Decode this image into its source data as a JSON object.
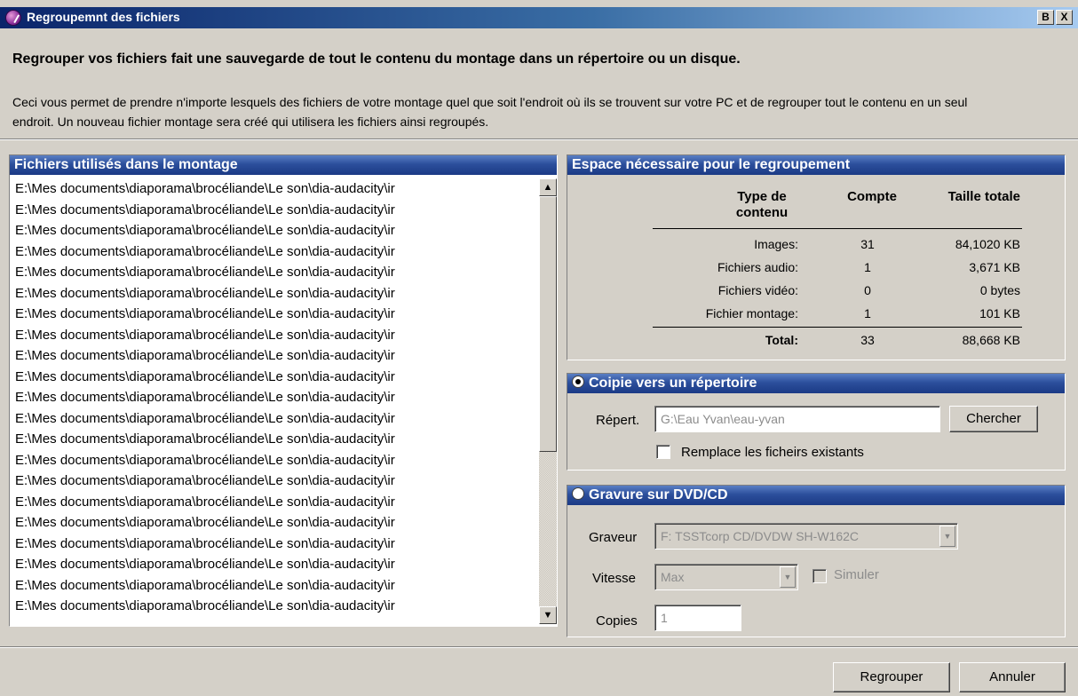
{
  "window": {
    "title": "Regroupemnt des fichiers",
    "restore_glyph": "B",
    "close_glyph": "X"
  },
  "intro": {
    "heading": "Regrouper vos fichiers fait une sauvegarde de tout le contenu du montage dans un répertoire ou un disque.",
    "description": "Ceci vous permet de prendre n'importe lesquels des fichiers de votre montage quel que soit l'endroit où ils se trouvent sur votre PC et de regrouper tout le contenu en un seul endroit. Un nouveau fichier montage sera créé qui utilisera les fichiers ainsi regroupés."
  },
  "files": {
    "title": "Fichiers utilisés dans le montage",
    "items": [
      "E:\\Mes documents\\diaporama\\brocéliande\\Le son\\dia-audacity\\ir",
      "E:\\Mes documents\\diaporama\\brocéliande\\Le son\\dia-audacity\\ir",
      "E:\\Mes documents\\diaporama\\brocéliande\\Le son\\dia-audacity\\ir",
      "E:\\Mes documents\\diaporama\\brocéliande\\Le son\\dia-audacity\\ir",
      "E:\\Mes documents\\diaporama\\brocéliande\\Le son\\dia-audacity\\ir",
      "E:\\Mes documents\\diaporama\\brocéliande\\Le son\\dia-audacity\\ir",
      "E:\\Mes documents\\diaporama\\brocéliande\\Le son\\dia-audacity\\ir",
      "E:\\Mes documents\\diaporama\\brocéliande\\Le son\\dia-audacity\\ir",
      "E:\\Mes documents\\diaporama\\brocéliande\\Le son\\dia-audacity\\ir",
      "E:\\Mes documents\\diaporama\\brocéliande\\Le son\\dia-audacity\\ir",
      "E:\\Mes documents\\diaporama\\brocéliande\\Le son\\dia-audacity\\ir",
      "E:\\Mes documents\\diaporama\\brocéliande\\Le son\\dia-audacity\\ir",
      "E:\\Mes documents\\diaporama\\brocéliande\\Le son\\dia-audacity\\ir",
      "E:\\Mes documents\\diaporama\\brocéliande\\Le son\\dia-audacity\\ir",
      "E:\\Mes documents\\diaporama\\brocéliande\\Le son\\dia-audacity\\ir",
      "E:\\Mes documents\\diaporama\\brocéliande\\Le son\\dia-audacity\\ir",
      "E:\\Mes documents\\diaporama\\brocéliande\\Le son\\dia-audacity\\ir",
      "E:\\Mes documents\\diaporama\\brocéliande\\Le son\\dia-audacity\\ir",
      "E:\\Mes documents\\diaporama\\brocéliande\\Le son\\dia-audacity\\ir",
      "E:\\Mes documents\\diaporama\\brocéliande\\Le son\\dia-audacity\\ir",
      "E:\\Mes documents\\diaporama\\brocéliande\\Le son\\dia-audacity\\ir"
    ]
  },
  "space": {
    "title": "Espace nécessaire pour le regroupement",
    "headers": {
      "type_line1": "Type de",
      "type_line2": "contenu",
      "count": "Compte",
      "size": "Taille totale"
    },
    "rows": [
      {
        "type": "Images:",
        "count": "31",
        "size": "84,1020 KB"
      },
      {
        "type": "Fichiers audio:",
        "count": "1",
        "size": "3,671 KB"
      },
      {
        "type": "Fichiers vidéo:",
        "count": "0",
        "size": "0 bytes"
      },
      {
        "type": "Fichier montage:",
        "count": "1",
        "size": "101 KB"
      }
    ],
    "total": {
      "label": "Total:",
      "count": "33",
      "size": "88,668 KB"
    }
  },
  "copy": {
    "title": "Coipie vers un répertoire",
    "selected": true,
    "folder_label": "Répert.",
    "folder_value": "G:\\Eau Yvan\\eau-yvan",
    "browse_label": "Chercher",
    "replace_label": "Remplace les ficheirs existants",
    "replace_checked": false
  },
  "burn": {
    "title": "Gravure sur DVD/CD",
    "selected": false,
    "burner_label": "Graveur",
    "burner_value": "F: TSSTcorp CD/DVDW SH-W162C",
    "speed_label": "Vitesse",
    "speed_value": "Max",
    "simulate_label": "Simuler",
    "copies_label": "Copies",
    "copies_value": "1"
  },
  "footer": {
    "ok_label": "Regrouper",
    "cancel_label": "Annuler"
  },
  "icons": {
    "app": "app-logo-icon",
    "scroll_up": "scroll-up-arrow-icon",
    "scroll_down": "scroll-down-arrow-icon",
    "dropdown": "dropdown-arrow-icon"
  }
}
